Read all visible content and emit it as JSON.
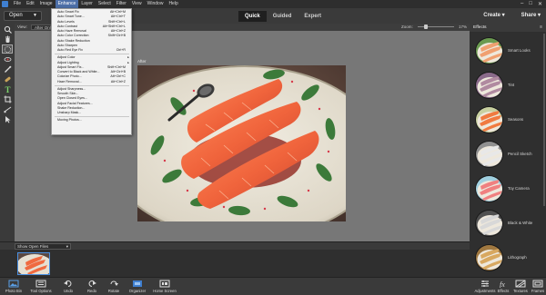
{
  "menubar": {
    "items": [
      "File",
      "Edit",
      "Image",
      "Enhance",
      "Layer",
      "Select",
      "Filter",
      "View",
      "Window",
      "Help"
    ],
    "active": "Enhance"
  },
  "topbar": {
    "open_label": "Open",
    "modes": [
      "Quick",
      "Guided",
      "Expert"
    ],
    "active_mode": "Quick",
    "create_label": "Create",
    "share_label": "Share"
  },
  "optbar": {
    "view_label": "View:",
    "view_value": "After Only",
    "zoom_label": "Zoom:",
    "zoom_value": "17%",
    "zoom_level_percent": 17
  },
  "canvas": {
    "after_label": "After"
  },
  "enhance_menu": [
    {
      "label": "Auto Smart Fix",
      "shortcut": "Alt+Ctrl+M"
    },
    {
      "label": "Auto Smart Tone...",
      "shortcut": "Alt+Ctrl+T"
    },
    {
      "label": "Auto Levels",
      "shortcut": "Shift+Ctrl+L"
    },
    {
      "label": "Auto Contrast",
      "shortcut": "Alt+Shift+Ctrl+L"
    },
    {
      "label": "Auto Haze Removal",
      "shortcut": "Alt+Ctrl+Z"
    },
    {
      "label": "Auto Color Correction",
      "shortcut": "Shift+Ctrl+B"
    },
    {
      "label": "Auto Shake Reduction",
      "shortcut": ""
    },
    {
      "label": "Auto Sharpen",
      "shortcut": ""
    },
    {
      "label": "Auto Red Eye Fix",
      "shortcut": "Ctrl+R"
    },
    {
      "sep": true
    },
    {
      "label": "Adjust Color",
      "shortcut": "",
      "submenu": true
    },
    {
      "label": "Adjust Lighting",
      "shortcut": "",
      "submenu": true
    },
    {
      "label": "Adjust Smart Fix...",
      "shortcut": "Shift+Ctrl+M"
    },
    {
      "label": "Convert to Black and White...",
      "shortcut": "Alt+Ctrl+B"
    },
    {
      "label": "Colorize Photo...",
      "shortcut": "Alt+Ctrl+C"
    },
    {
      "label": "Haze Removal...",
      "shortcut": "Alt+Ctrl+Z"
    },
    {
      "sep": true
    },
    {
      "label": "Adjust Sharpness...",
      "shortcut": ""
    },
    {
      "label": "Smooth Skin...",
      "shortcut": ""
    },
    {
      "label": "Open Closed Eyes...",
      "shortcut": ""
    },
    {
      "label": "Adjust Facial Features...",
      "shortcut": ""
    },
    {
      "label": "Shake Reduction...",
      "shortcut": ""
    },
    {
      "label": "Unsharp Mask...",
      "shortcut": ""
    },
    {
      "sep": true
    },
    {
      "label": "Moving Photos...",
      "shortcut": ""
    }
  ],
  "photobin": {
    "select_label": "Show Open Files"
  },
  "effects": {
    "tab_label": "Effects",
    "items": [
      "Smart Looks",
      "Tint",
      "Seasons",
      "Pencil Sketch",
      "Toy Camera",
      "Black & White",
      "Lithograph"
    ]
  },
  "bottombar": {
    "left": [
      "Photo Bin",
      "Tool Options",
      "Undo",
      "Redo",
      "Rotate",
      "Organizer",
      "Home Screen"
    ],
    "right": [
      "Adjustments",
      "Effects",
      "Textures",
      "Frames"
    ]
  },
  "colors": {
    "menu_highlight": "#4d6fa8",
    "selection_accent": "#4a90e2",
    "panel_bg": "#3a3a3a",
    "canvas_bg": "#777777"
  }
}
